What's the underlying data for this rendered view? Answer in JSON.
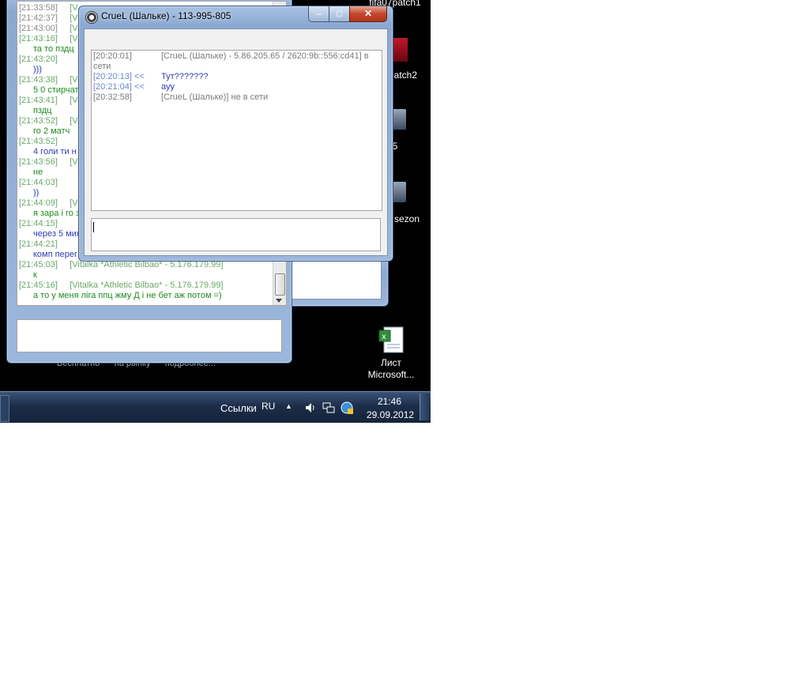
{
  "desktop": {
    "icons": [
      {
        "label": "fifa07patch1"
      },
      {
        "label": "patch2"
      },
      {
        "label": "5"
      },
      {
        "label": "sezon"
      },
      {
        "label": "Лист"
      },
      {
        "label": "Microsoft..."
      }
    ],
    "obscured_text": "Бесплатно      на рынку      подробнее..."
  },
  "back_window": {
    "rows": [
      {
        "time": "[21:33:58]",
        "tag": "[V"
      },
      {
        "time": "[21:42:37]",
        "tag": "[V"
      },
      {
        "time": "[21:43:00]",
        "tag": "[V"
      },
      {
        "time": "[21:43:16]",
        "tag": "[V"
      },
      {
        "text": "та то пздц"
      },
      {
        "time": "[21:43:20]"
      },
      {
        "text": ")))"
      },
      {
        "time": "[21:43:38]",
        "tag": "[V"
      },
      {
        "text": "5 0 стирчат"
      },
      {
        "time": "[21:43:41]",
        "tag": "[V"
      },
      {
        "text": "пздц"
      },
      {
        "time": "[21:43:52]",
        "tag": "[V"
      },
      {
        "text": "го 2 матч"
      },
      {
        "time": "[21:43:52]"
      },
      {
        "text": "4 голи ти н"
      },
      {
        "time": "[21:43:56]",
        "tag": "[V"
      },
      {
        "text": "не"
      },
      {
        "time": "[21:44:03]"
      },
      {
        "text": "))"
      },
      {
        "time": "[21:44:09]",
        "tag": "[V"
      },
      {
        "text": "я зара і го з"
      },
      {
        "time": "[21:44:15]"
      },
      {
        "text": "через 5 мин"
      },
      {
        "time": "[21:44:21]"
      },
      {
        "text": "комп перег"
      },
      {
        "time": "[21:45:03]",
        "tag": "[Vitalka *Athletic Bilbao*  - 5.176.179.99]"
      },
      {
        "text": "к"
      },
      {
        "time": "[21:45:16]",
        "tag": "[Vitalka *Athletic Bilbao*  - 5.176.179.99]"
      },
      {
        "text": "а то у меня ліга ппц жму Д і не бет аж потом =)"
      }
    ]
  },
  "chat_window": {
    "title": "CrueL (Шальке) - 113-995-805",
    "buttons": {
      "minimize": "‒",
      "maximize": "□",
      "close": "✕"
    },
    "messages": [
      {
        "time": "[20:20:01]",
        "dir": "",
        "text": "[CrueL (Шальке) - 5.86.205.65 / 2620:9b::556:cd41] в"
      },
      {
        "time": "",
        "dir": "",
        "text": "сети"
      },
      {
        "time": "[20:20:13]",
        "dir": "<<",
        "text": "Тут???????"
      },
      {
        "time": "[20:21:04]",
        "dir": "<<",
        "text": "ауу"
      },
      {
        "time": "[20:32:58]",
        "dir": "",
        "text": "[CrueL (Шальке)] не в сети"
      }
    ],
    "input_value": ""
  },
  "taskbar": {
    "links_label": "Ссылки",
    "lang": "RU",
    "time": "21:46",
    "date": "29.09.2012"
  }
}
